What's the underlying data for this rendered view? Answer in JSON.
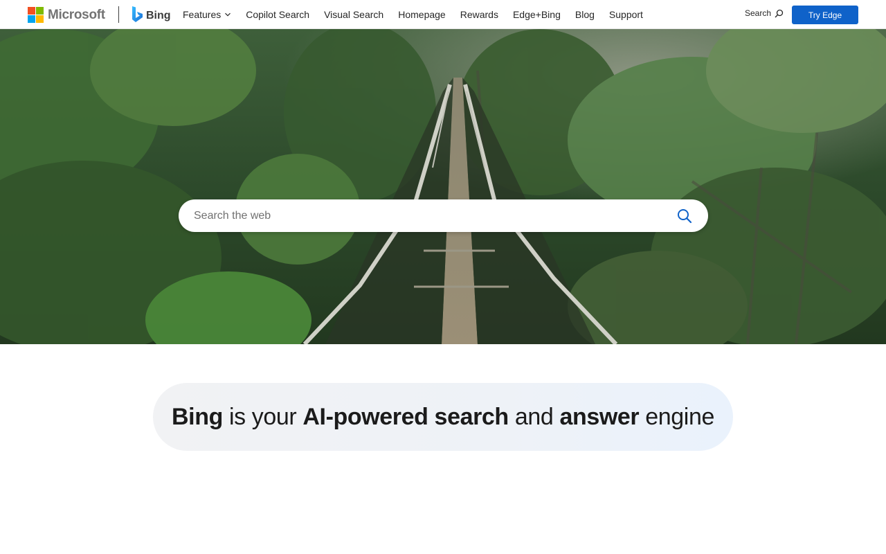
{
  "header": {
    "ms_wordmark": "Microsoft",
    "bing_wordmark": "Bing",
    "nav": [
      {
        "label": "Features",
        "has_dropdown": true
      },
      {
        "label": "Copilot Search"
      },
      {
        "label": "Visual Search"
      },
      {
        "label": "Homepage"
      },
      {
        "label": "Rewards"
      },
      {
        "label": "Edge+Bing"
      },
      {
        "label": "Blog"
      },
      {
        "label": "Support"
      }
    ],
    "search_label": "Search",
    "try_edge_label": "Try Edge"
  },
  "hero": {
    "search_placeholder": "Search the web",
    "search_value": ""
  },
  "tagline": {
    "part1": "Bing",
    "part2": " is your ",
    "part3": "AI-powered search",
    "part4": " and ",
    "part5": "answer",
    "part6": " engine"
  },
  "colors": {
    "accent": "#0f62c9",
    "ms_red": "#f25022",
    "ms_green": "#7fba00",
    "ms_blue": "#00a4ef",
    "ms_yellow": "#ffb900"
  },
  "icons": {
    "search": "search-icon",
    "chevron": "chevron-down-icon",
    "bing_logo": "bing-logo-icon"
  }
}
